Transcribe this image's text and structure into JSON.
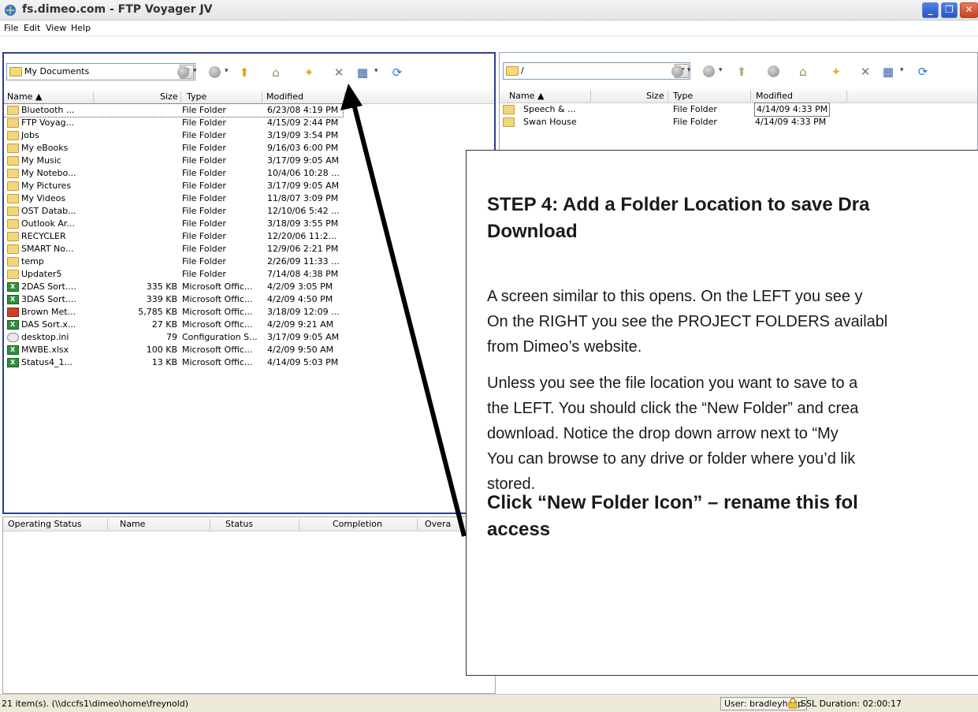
{
  "window": {
    "title": "fs.dimeo.com - FTP Voyager JV",
    "min_label": "_",
    "max_label": "❐",
    "close_label": "✕"
  },
  "menu": [
    "File",
    "Edit",
    "View",
    "Help"
  ],
  "left": {
    "path": "My Documents",
    "columns": [
      "Name ▲",
      "Size",
      "Type",
      "Modified"
    ],
    "rows": [
      {
        "icon": "folder",
        "name": "Bluetooth ...",
        "size": "",
        "type": "File Folder",
        "modified": "6/23/08 4:19 PM"
      },
      {
        "icon": "folder",
        "name": "FTP Voyag...",
        "size": "",
        "type": "File Folder",
        "modified": "4/15/09 2:44 PM"
      },
      {
        "icon": "folder",
        "name": "Jobs",
        "size": "",
        "type": "File Folder",
        "modified": "3/19/09 3:54 PM"
      },
      {
        "icon": "folder",
        "name": "My eBooks",
        "size": "",
        "type": "File Folder",
        "modified": "9/16/03 6:00 PM"
      },
      {
        "icon": "folder",
        "name": "My Music",
        "size": "",
        "type": "File Folder",
        "modified": "3/17/09 9:05 AM"
      },
      {
        "icon": "folder",
        "name": "My Notebo...",
        "size": "",
        "type": "File Folder",
        "modified": "10/4/06 10:28 ..."
      },
      {
        "icon": "folder",
        "name": "My Pictures",
        "size": "",
        "type": "File Folder",
        "modified": "3/17/09 9:05 AM"
      },
      {
        "icon": "folder",
        "name": "My Videos",
        "size": "",
        "type": "File Folder",
        "modified": "11/8/07 3:09 PM"
      },
      {
        "icon": "folder",
        "name": "OST Datab...",
        "size": "",
        "type": "File Folder",
        "modified": "12/10/06 5:42 ..."
      },
      {
        "icon": "folder",
        "name": "Outlook Ar...",
        "size": "",
        "type": "File Folder",
        "modified": "3/18/09 3:55 PM"
      },
      {
        "icon": "folder",
        "name": "RECYCLER",
        "size": "",
        "type": "File Folder",
        "modified": "12/20/06 11:2..."
      },
      {
        "icon": "folder",
        "name": "SMART No...",
        "size": "",
        "type": "File Folder",
        "modified": "12/9/06 2:21 PM"
      },
      {
        "icon": "folder",
        "name": "temp",
        "size": "",
        "type": "File Folder",
        "modified": "2/26/09 11:33 ..."
      },
      {
        "icon": "folder",
        "name": "Updater5",
        "size": "",
        "type": "File Folder",
        "modified": "7/14/08 4:38 PM"
      },
      {
        "icon": "excel",
        "name": "2DAS Sort....",
        "size": "335 KB",
        "type": "Microsoft Offic...",
        "modified": "4/2/09 3:05 PM"
      },
      {
        "icon": "excel",
        "name": "3DAS Sort....",
        "size": "339 KB",
        "type": "Microsoft Offic...",
        "modified": "4/2/09 4:50 PM"
      },
      {
        "icon": "ppt",
        "name": "Brown Met...",
        "size": "5,785 KB",
        "type": "Microsoft Offic...",
        "modified": "3/18/09 12:09 ..."
      },
      {
        "icon": "excel",
        "name": "DAS Sort.x...",
        "size": "27 KB",
        "type": "Microsoft Offic...",
        "modified": "4/2/09 9:21 AM"
      },
      {
        "icon": "ini",
        "name": "desktop.ini",
        "size": "79",
        "type": "Configuration S...",
        "modified": "3/17/09 9:05 AM"
      },
      {
        "icon": "excel",
        "name": "MWBE.xlsx",
        "size": "100 KB",
        "type": "Microsoft Offic...",
        "modified": "4/2/09 9:50 AM"
      },
      {
        "icon": "excel",
        "name": "Status4_1...",
        "size": "13 KB",
        "type": "Microsoft Offic...",
        "modified": "4/14/09 5:03 PM"
      }
    ]
  },
  "right": {
    "path": "/",
    "columns": [
      "Name ▲",
      "Size",
      "Type",
      "Modified"
    ],
    "rows": [
      {
        "icon": "folder",
        "name": "Speech & ...",
        "size": "",
        "type": "File Folder",
        "modified": "4/14/09 4:33 PM"
      },
      {
        "icon": "folder",
        "name": "Swan House",
        "size": "",
        "type": "File Folder",
        "modified": "4/14/09 4:33 PM"
      }
    ]
  },
  "transfer": {
    "columns": [
      "Operating Status",
      "Name",
      "Status",
      "Completion",
      "Overa"
    ]
  },
  "status": {
    "left": "21 item(s).  (\\\\dccfs1\\dimeo\\home\\freynold)",
    "user": "User:  bradleyhosp",
    "ssl": "SSL Duration:  02:00:17"
  },
  "callout": {
    "heading_line1": "STEP 4: Add a Folder Location to save Dra",
    "heading_line2": "Download",
    "lines": [
      "A screen similar to this opens.  On the LEFT you see y",
      "On the RIGHT you see the PROJECT FOLDERS availabl",
      "from Dimeo’s website.",
      "Unless you see the file location you want to save to a",
      "the LEFT.  You should click the “New Folder” and crea",
      "download.  Notice the drop down arrow next to “My",
      "You can browse to any drive or folder where you’d lik",
      "stored."
    ],
    "cta_line1": "Click “New Folder Icon” – rename this fol",
    "cta_line2": "access"
  },
  "colors": {
    "pane_border": "#2a3f96",
    "folder": "#f4d57a",
    "titlebar_close": "#c4441f"
  }
}
